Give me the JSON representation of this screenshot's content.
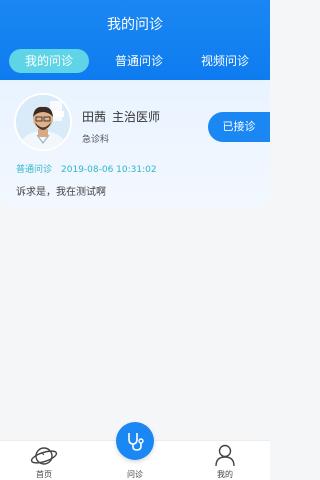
{
  "header": {
    "title": "我的问诊",
    "tabs": [
      {
        "label": "我的问诊",
        "active": true
      },
      {
        "label": "普通问诊",
        "active": false
      },
      {
        "label": "视频问诊",
        "active": false
      }
    ],
    "accent_color": "#1a87f3",
    "active_tab_color": "#5fd4e6"
  },
  "consultation": {
    "doctor_name": "田茜",
    "doctor_title": "主治医师",
    "department": "急诊科",
    "status_label": "已接诊",
    "type": "普通问诊",
    "time": "2019-08-06 10:31:02",
    "complaint": "诉求是，我在测试啊",
    "avatar_icon": "doctor-avatar-photo"
  },
  "tabbar": {
    "items": [
      {
        "label": "首页",
        "icon": "planet-icon"
      },
      {
        "label": "问诊",
        "icon": "stethoscope-icon"
      },
      {
        "label": "我的",
        "icon": "user-icon"
      }
    ]
  }
}
